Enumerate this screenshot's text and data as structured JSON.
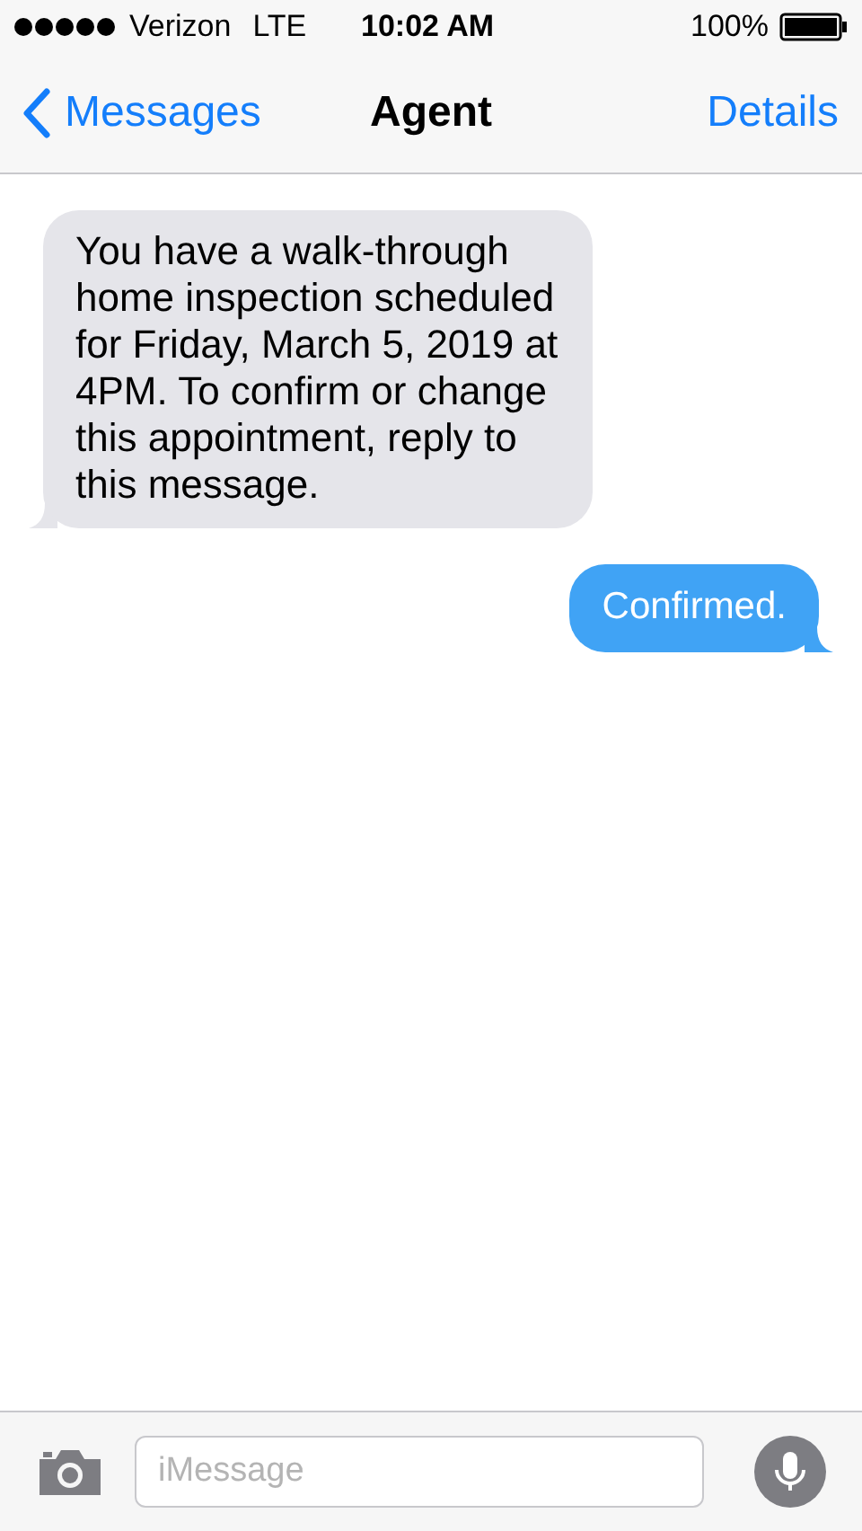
{
  "status_bar": {
    "carrier": "Verizon",
    "network": "LTE",
    "time": "10:02 AM",
    "battery": "100%"
  },
  "nav_bar": {
    "back": "Messages",
    "title": "Agent",
    "action": "Details"
  },
  "messages": [
    {
      "kind": "received",
      "text": "You have a walk-through home inspection scheduled for Friday, March 5, 2019 at 4PM. To confirm or change this appointment, reply to this message."
    },
    {
      "kind": "sent",
      "text": "Confirmed."
    }
  ],
  "composer": {
    "placeholder": "iMessage"
  }
}
